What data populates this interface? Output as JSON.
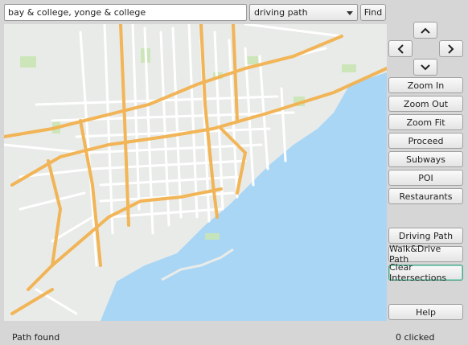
{
  "search": {
    "value": "bay & college, yonge & college"
  },
  "mode_select": {
    "selected": "driving path"
  },
  "find_button": "Find",
  "nav": {
    "up": "up",
    "down": "down",
    "left": "left",
    "right": "right"
  },
  "side_buttons": {
    "zoom_in": "Zoom In",
    "zoom_out": "Zoom Out",
    "zoom_fit": "Zoom Fit",
    "proceed": "Proceed",
    "subways": "Subways",
    "poi": "POI",
    "restaurants": "Restaurants",
    "driving_path": "Driving Path",
    "walk_drive_path": "Walk&Drive Path",
    "clear_intersections": "Clear Intersections",
    "help": "Help"
  },
  "status": {
    "message": "Path found",
    "clicked": "0 clicked"
  },
  "colors": {
    "water": "#a9d6f5",
    "land": "#e9ebe8",
    "street": "#ffffff",
    "highway": "#f2b24f",
    "park": "#c9e6b5",
    "focus_border": "#4fa38a"
  }
}
